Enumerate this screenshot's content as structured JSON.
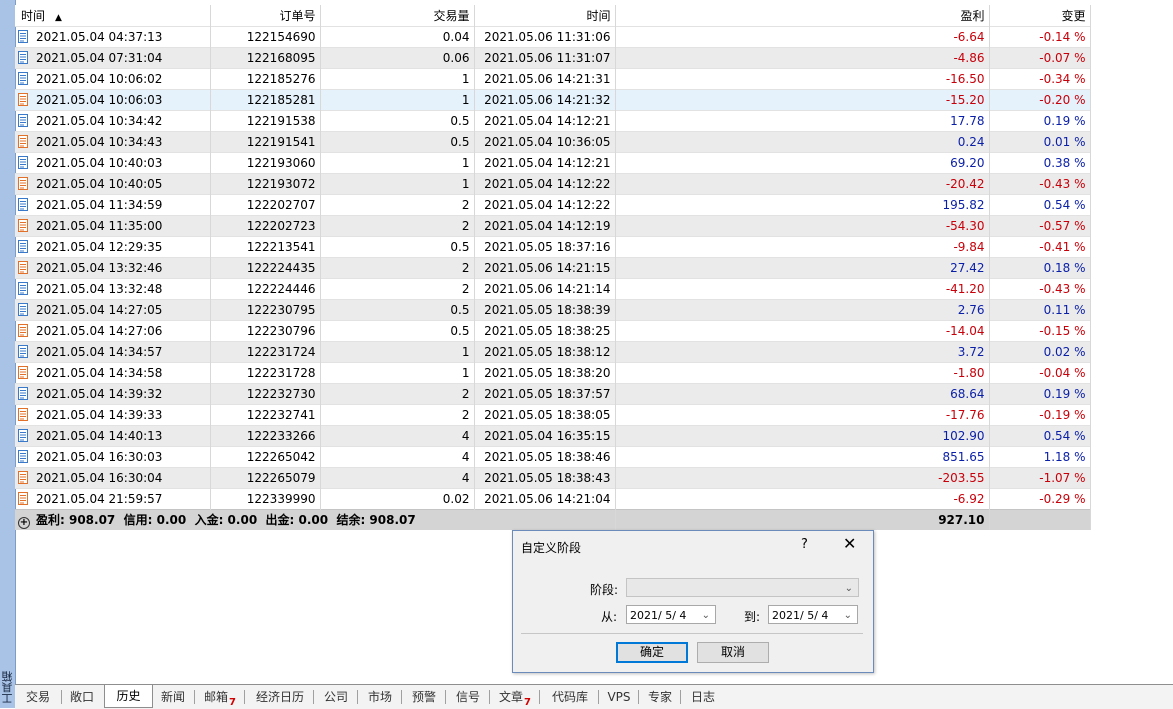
{
  "sidebar": {
    "label": "工具箱"
  },
  "table": {
    "headers": {
      "time": "时间",
      "order": "订单号",
      "volume": "交易量",
      "close_time": "时间",
      "profit": "盈利",
      "change": "变更"
    },
    "sort_arrow": "▲",
    "rows": [
      {
        "type": "buy",
        "time": "2021.05.04 04:37:13",
        "order": "122154690",
        "volume": "0.04",
        "close_time": "2021.05.06 11:31:06",
        "profit": "-6.64",
        "change": "-0.14 %",
        "sign": "neg"
      },
      {
        "type": "buy",
        "time": "2021.05.04 07:31:04",
        "order": "122168095",
        "volume": "0.06",
        "close_time": "2021.05.06 11:31:07",
        "profit": "-4.86",
        "change": "-0.07 %",
        "sign": "neg"
      },
      {
        "type": "buy",
        "time": "2021.05.04 10:06:02",
        "order": "122185276",
        "volume": "1",
        "close_time": "2021.05.06 14:21:31",
        "profit": "-16.50",
        "change": "-0.34 %",
        "sign": "neg"
      },
      {
        "type": "sell",
        "time": "2021.05.04 10:06:03",
        "order": "122185281",
        "volume": "1",
        "close_time": "2021.05.06 14:21:32",
        "profit": "-15.20",
        "change": "-0.20 %",
        "sign": "neg"
      },
      {
        "type": "buy",
        "time": "2021.05.04 10:34:42",
        "order": "122191538",
        "volume": "0.5",
        "close_time": "2021.05.04 14:12:21",
        "profit": "17.78",
        "change": "0.19 %",
        "sign": "pos"
      },
      {
        "type": "sell",
        "time": "2021.05.04 10:34:43",
        "order": "122191541",
        "volume": "0.5",
        "close_time": "2021.05.04 10:36:05",
        "profit": "0.24",
        "change": "0.01 %",
        "sign": "pos"
      },
      {
        "type": "buy",
        "time": "2021.05.04 10:40:03",
        "order": "122193060",
        "volume": "1",
        "close_time": "2021.05.04 14:12:21",
        "profit": "69.20",
        "change": "0.38 %",
        "sign": "pos"
      },
      {
        "type": "sell",
        "time": "2021.05.04 10:40:05",
        "order": "122193072",
        "volume": "1",
        "close_time": "2021.05.04 14:12:22",
        "profit": "-20.42",
        "change": "-0.43 %",
        "sign": "neg"
      },
      {
        "type": "buy",
        "time": "2021.05.04 11:34:59",
        "order": "122202707",
        "volume": "2",
        "close_time": "2021.05.04 14:12:22",
        "profit": "195.82",
        "change": "0.54 %",
        "sign": "pos"
      },
      {
        "type": "sell",
        "time": "2021.05.04 11:35:00",
        "order": "122202723",
        "volume": "2",
        "close_time": "2021.05.04 14:12:19",
        "profit": "-54.30",
        "change": "-0.57 %",
        "sign": "neg"
      },
      {
        "type": "buy",
        "time": "2021.05.04 12:29:35",
        "order": "122213541",
        "volume": "0.5",
        "close_time": "2021.05.05 18:37:16",
        "profit": "-9.84",
        "change": "-0.41 %",
        "sign": "neg"
      },
      {
        "type": "sell",
        "time": "2021.05.04 13:32:46",
        "order": "122224435",
        "volume": "2",
        "close_time": "2021.05.06 14:21:15",
        "profit": "27.42",
        "change": "0.18 %",
        "sign": "pos"
      },
      {
        "type": "buy",
        "time": "2021.05.04 13:32:48",
        "order": "122224446",
        "volume": "2",
        "close_time": "2021.05.06 14:21:14",
        "profit": "-41.20",
        "change": "-0.43 %",
        "sign": "neg"
      },
      {
        "type": "buy",
        "time": "2021.05.04 14:27:05",
        "order": "122230795",
        "volume": "0.5",
        "close_time": "2021.05.05 18:38:39",
        "profit": "2.76",
        "change": "0.11 %",
        "sign": "pos"
      },
      {
        "type": "sell",
        "time": "2021.05.04 14:27:06",
        "order": "122230796",
        "volume": "0.5",
        "close_time": "2021.05.05 18:38:25",
        "profit": "-14.04",
        "change": "-0.15 %",
        "sign": "neg"
      },
      {
        "type": "buy",
        "time": "2021.05.04 14:34:57",
        "order": "122231724",
        "volume": "1",
        "close_time": "2021.05.05 18:38:12",
        "profit": "3.72",
        "change": "0.02 %",
        "sign": "pos"
      },
      {
        "type": "sell",
        "time": "2021.05.04 14:34:58",
        "order": "122231728",
        "volume": "1",
        "close_time": "2021.05.05 18:38:20",
        "profit": "-1.80",
        "change": "-0.04 %",
        "sign": "neg"
      },
      {
        "type": "buy",
        "time": "2021.05.04 14:39:32",
        "order": "122232730",
        "volume": "2",
        "close_time": "2021.05.05 18:37:57",
        "profit": "68.64",
        "change": "0.19 %",
        "sign": "pos"
      },
      {
        "type": "sell",
        "time": "2021.05.04 14:39:33",
        "order": "122232741",
        "volume": "2",
        "close_time": "2021.05.05 18:38:05",
        "profit": "-17.76",
        "change": "-0.19 %",
        "sign": "neg"
      },
      {
        "type": "buy",
        "time": "2021.05.04 14:40:13",
        "order": "122233266",
        "volume": "4",
        "close_time": "2021.05.04 16:35:15",
        "profit": "102.90",
        "change": "0.54 %",
        "sign": "pos"
      },
      {
        "type": "buy",
        "time": "2021.05.04 16:30:03",
        "order": "122265042",
        "volume": "4",
        "close_time": "2021.05.05 18:38:46",
        "profit": "851.65",
        "change": "1.18 %",
        "sign": "pos"
      },
      {
        "type": "sell",
        "time": "2021.05.04 16:30:04",
        "order": "122265079",
        "volume": "4",
        "close_time": "2021.05.05 18:38:43",
        "profit": "-203.55",
        "change": "-1.07 %",
        "sign": "neg"
      },
      {
        "type": "sell",
        "time": "2021.05.04 21:59:57",
        "order": "122339990",
        "volume": "0.02",
        "close_time": "2021.05.06 14:21:04",
        "profit": "-6.92",
        "change": "-0.29 %",
        "sign": "neg"
      }
    ],
    "selected_row": 3,
    "summary": {
      "text": "盈利: 908.07  信用: 0.00  入金: 0.00  出金: 0.00  结余: 908.07",
      "total_profit": "927.10"
    }
  },
  "dialog": {
    "title": "自定义阶段",
    "help": "?",
    "close": "✕",
    "period_label": "阶段:",
    "period_value": "",
    "from_label": "从:",
    "from_value": "2021/ 5/ 4",
    "to_label": "到:",
    "to_value": "2021/ 5/ 4",
    "ok_label": "确定",
    "cancel_label": "取消"
  },
  "tabs": [
    {
      "label": "交易",
      "badge": ""
    },
    {
      "label": "敞口",
      "badge": ""
    },
    {
      "label": "历史",
      "badge": "",
      "active": true
    },
    {
      "label": "新闻",
      "badge": ""
    },
    {
      "label": "邮箱",
      "badge": "7"
    },
    {
      "label": "经济日历",
      "badge": ""
    },
    {
      "label": "公司",
      "badge": ""
    },
    {
      "label": "市场",
      "badge": ""
    },
    {
      "label": "预警",
      "badge": ""
    },
    {
      "label": "信号",
      "badge": ""
    },
    {
      "label": "文章",
      "badge": "7"
    },
    {
      "label": "代码库",
      "badge": ""
    },
    {
      "label": "VPS",
      "badge": ""
    },
    {
      "label": "专家",
      "badge": ""
    },
    {
      "label": "日志",
      "badge": ""
    }
  ],
  "colors": {
    "negative": "#c8000a",
    "positive": "#0a1fa8",
    "buy_icon": "#3a78c9",
    "sell_icon": "#e0702a",
    "strip": "#a9c3e6"
  }
}
